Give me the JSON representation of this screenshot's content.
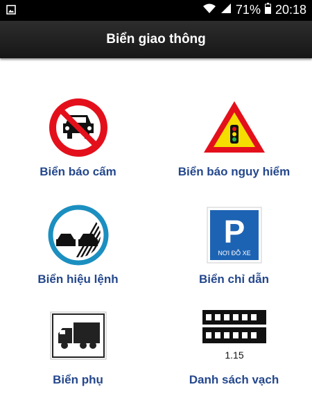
{
  "status_bar": {
    "battery_percent": "71%",
    "time": "20:18"
  },
  "app_bar": {
    "title": "Biển giao thông"
  },
  "tiles": [
    {
      "label": "Biển báo cấm",
      "icon": "no-cars-prohibition-sign-icon"
    },
    {
      "label": "Biển báo nguy hiểm",
      "icon": "traffic-light-warning-sign-icon"
    },
    {
      "label": "Biển hiệu lệnh",
      "icon": "end-no-overtaking-sign-icon"
    },
    {
      "label": "Biển chỉ dẫn",
      "icon": "parking-sign-icon"
    },
    {
      "label": "Biển phụ",
      "icon": "truck-supplementary-sign-icon"
    },
    {
      "label": "Danh sách vạch",
      "icon": "road-marking-icon"
    }
  ],
  "signs": {
    "parking_letter": "P",
    "parking_caption": "NƠI ĐỖ XE",
    "marking_code": "1.15"
  },
  "colors": {
    "title_text": "#24478c",
    "sign_red": "#e3101b",
    "sign_blue": "#1d63b3",
    "warning_yellow": "#f6dd00"
  }
}
